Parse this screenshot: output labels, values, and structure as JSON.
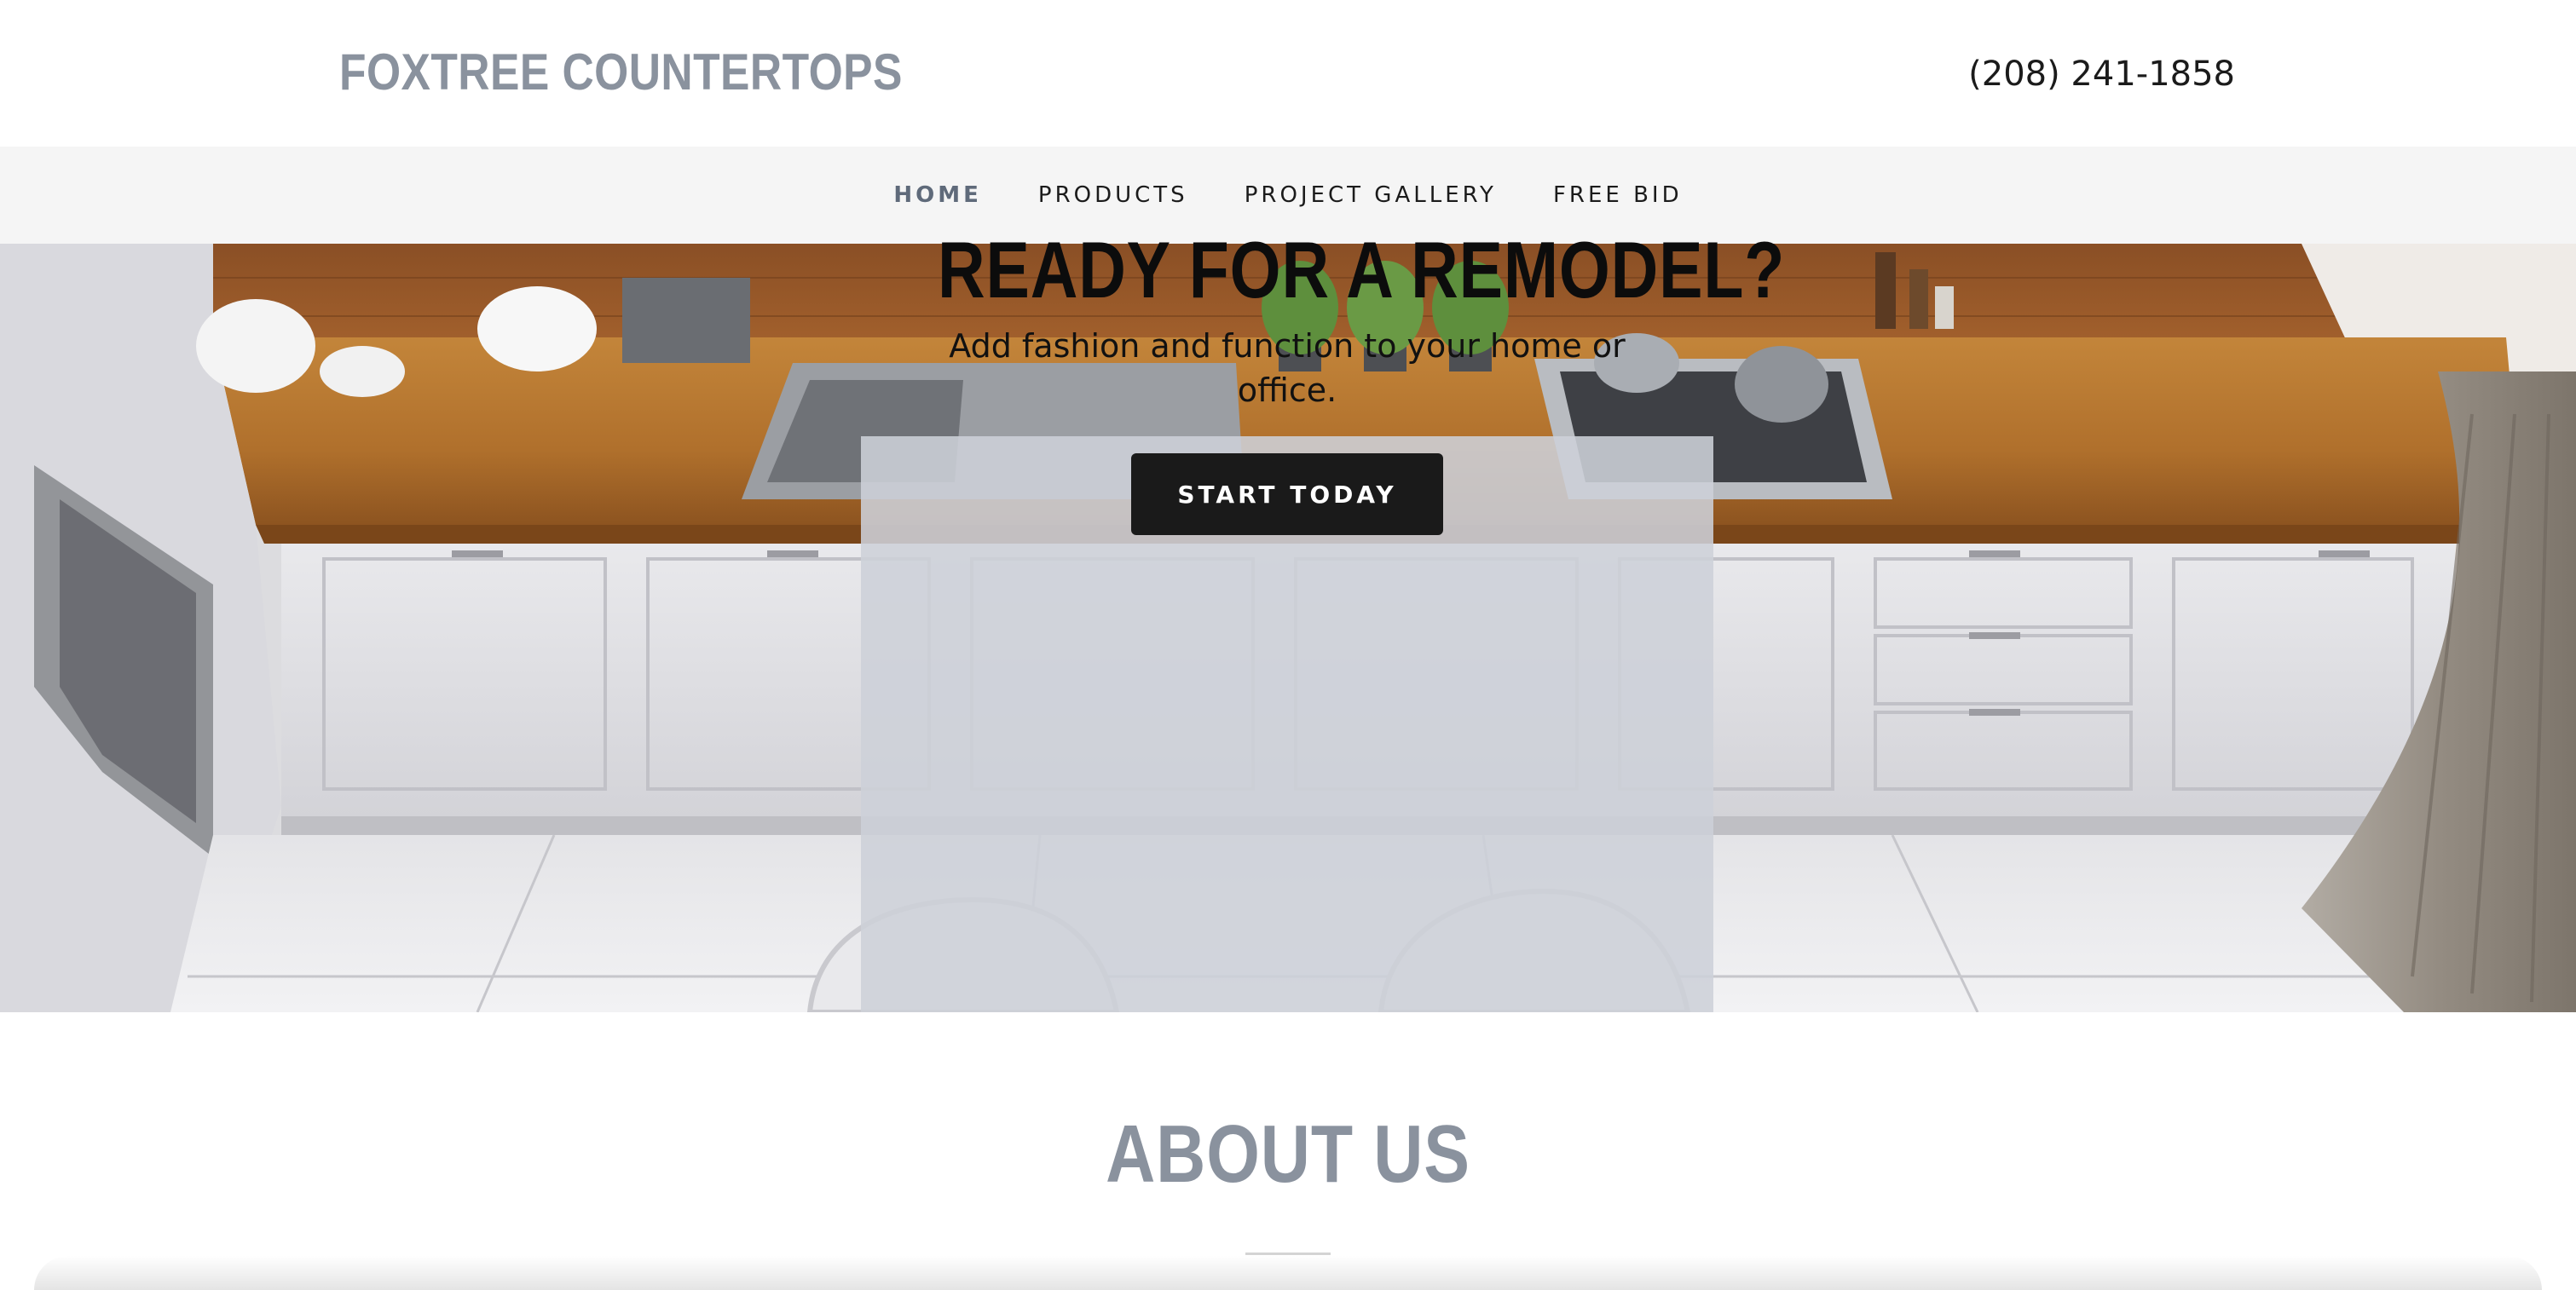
{
  "header": {
    "brand": "FOXTREE COUNTERTOPS",
    "phone": "(208) 241-1858"
  },
  "nav": {
    "items": [
      {
        "label": "HOME",
        "active": true
      },
      {
        "label": "PRODUCTS",
        "active": false
      },
      {
        "label": "PROJECT GALLERY",
        "active": false
      },
      {
        "label": "FREE BID",
        "active": false
      }
    ]
  },
  "hero": {
    "title": "READY FOR A REMODEL?",
    "subtitle": "Add fashion and function to your home or office.",
    "cta": "START TODAY"
  },
  "about": {
    "title": "ABOUT US"
  },
  "colors": {
    "brand": "#8a929e",
    "nav_active": "#5f6a7a",
    "button": "#1a1a1a",
    "nav_bg": "#f5f5f5",
    "countertop": "#b7772f"
  }
}
